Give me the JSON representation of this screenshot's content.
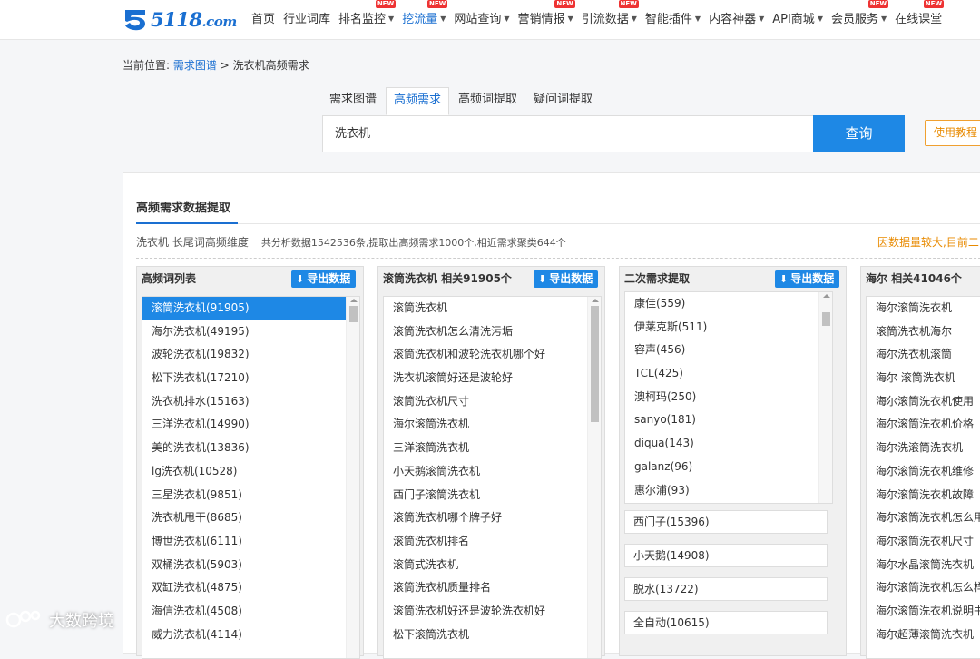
{
  "brand": {
    "name": "5118",
    "suffix": ".com"
  },
  "nav": {
    "items": [
      {
        "label": "首页",
        "caret": false,
        "badge": ""
      },
      {
        "label": "行业词库",
        "caret": false,
        "badge": ""
      },
      {
        "label": "排名监控",
        "caret": true,
        "badge": "NEW"
      },
      {
        "label": "挖流量",
        "caret": true,
        "badge": "NEW",
        "active": true
      },
      {
        "label": "网站查询",
        "caret": true,
        "badge": ""
      },
      {
        "label": "营销情报",
        "caret": true,
        "badge": "NEW"
      },
      {
        "label": "引流数据",
        "caret": true,
        "badge": "NEW"
      },
      {
        "label": "智能插件",
        "caret": true,
        "badge": ""
      },
      {
        "label": "内容神器",
        "caret": true,
        "badge": ""
      },
      {
        "label": "API商城",
        "caret": true,
        "badge": ""
      },
      {
        "label": "会员服务",
        "caret": true,
        "badge": "NEW"
      },
      {
        "label": "在线课堂",
        "caret": false,
        "badge": "NEW"
      }
    ]
  },
  "breadcrumb": {
    "prefix": "当前位置:",
    "link": "需求图谱",
    "sep": " > ",
    "current": "洗衣机高频需求"
  },
  "tabs": [
    {
      "label": "需求图谱",
      "active": false
    },
    {
      "label": "高频需求",
      "active": true
    },
    {
      "label": "高频词提取",
      "active": false
    },
    {
      "label": "疑问词提取",
      "active": false
    }
  ],
  "search": {
    "value": "洗衣机",
    "button": "查询",
    "tutorial": "使用教程 ▾"
  },
  "card": {
    "title": "高频需求数据提取",
    "summary_main": "洗衣机 长尾词高频维度",
    "summary_sub": "共分析数据1542536条,提取出高频需求1000个,相近需求聚类644个",
    "warning": "因数据量较大,目前二"
  },
  "panels": [
    {
      "title": "高频词列表",
      "export": "导出数据",
      "items": [
        "滚筒洗衣机(91905)",
        "海尔洗衣机(49195)",
        "波轮洗衣机(19832)",
        "松下洗衣机(17210)",
        "洗衣机排水(15163)",
        "三洋洗衣机(14990)",
        "美的洗衣机(13836)",
        "lg洗衣机(10528)",
        "三星洗衣机(9851)",
        "洗衣机甩干(8685)",
        "博世洗衣机(6111)",
        "双桶洗衣机(5903)",
        "双缸洗衣机(4875)",
        "海信洗衣机(4508)",
        "威力洗衣机(4114)"
      ]
    },
    {
      "title": "滚筒洗衣机 相关91905个",
      "export": "导出数据",
      "items": [
        "滚筒洗衣机",
        "滚筒洗衣机怎么清洗污垢",
        "滚筒洗衣机和波轮洗衣机哪个好",
        "洗衣机滚筒好还是波轮好",
        "滚筒洗衣机尺寸",
        "海尔滚筒洗衣机",
        "三洋滚筒洗衣机",
        "小天鹅滚筒洗衣机",
        "西门子滚筒洗衣机",
        "滚筒洗衣机哪个牌子好",
        "滚筒洗衣机排名",
        "滚筒式洗衣机",
        "滚筒洗衣机质量排名",
        "滚筒洗衣机好还是波轮洗衣机好",
        "松下滚筒洗衣机"
      ]
    },
    {
      "title": "二次需求提取",
      "export": "导出数据",
      "items": [
        "康佳(559)",
        "伊莱克斯(511)",
        "容声(456)",
        "TCL(425)",
        "澳柯玛(250)",
        "sanyo(181)",
        "diqua(143)",
        "galanz(96)",
        "惠尔浦(93)"
      ],
      "groups": [
        "西门子(15396)",
        "小天鹅(14908)",
        "脱水(13722)",
        "全自动(10615)"
      ]
    },
    {
      "title": "海尔 相关41046个",
      "items": [
        "海尔滚筒洗衣机",
        "滚筒洗衣机海尔",
        "海尔洗衣机滚筒",
        "海尔 滚筒洗衣机",
        "海尔滚筒洗衣机使用",
        "海尔滚筒洗衣机价格",
        "海尔洗滚筒洗衣机",
        "海尔滚筒洗衣机维修",
        "海尔滚筒洗衣机故障",
        "海尔滚筒洗衣机怎么用",
        "海尔滚筒洗衣机尺寸",
        "海尔水晶滚筒洗衣机",
        "海尔滚筒洗衣机怎么样",
        "海尔滚筒洗衣机说明书",
        "海尔超薄滚筒洗衣机"
      ]
    }
  ],
  "watermark": "大数跨境",
  "colors": {
    "accent": "#1e88e5",
    "link": "#1a6fd1",
    "warning": "#e88a00",
    "badge": "#e33333"
  }
}
